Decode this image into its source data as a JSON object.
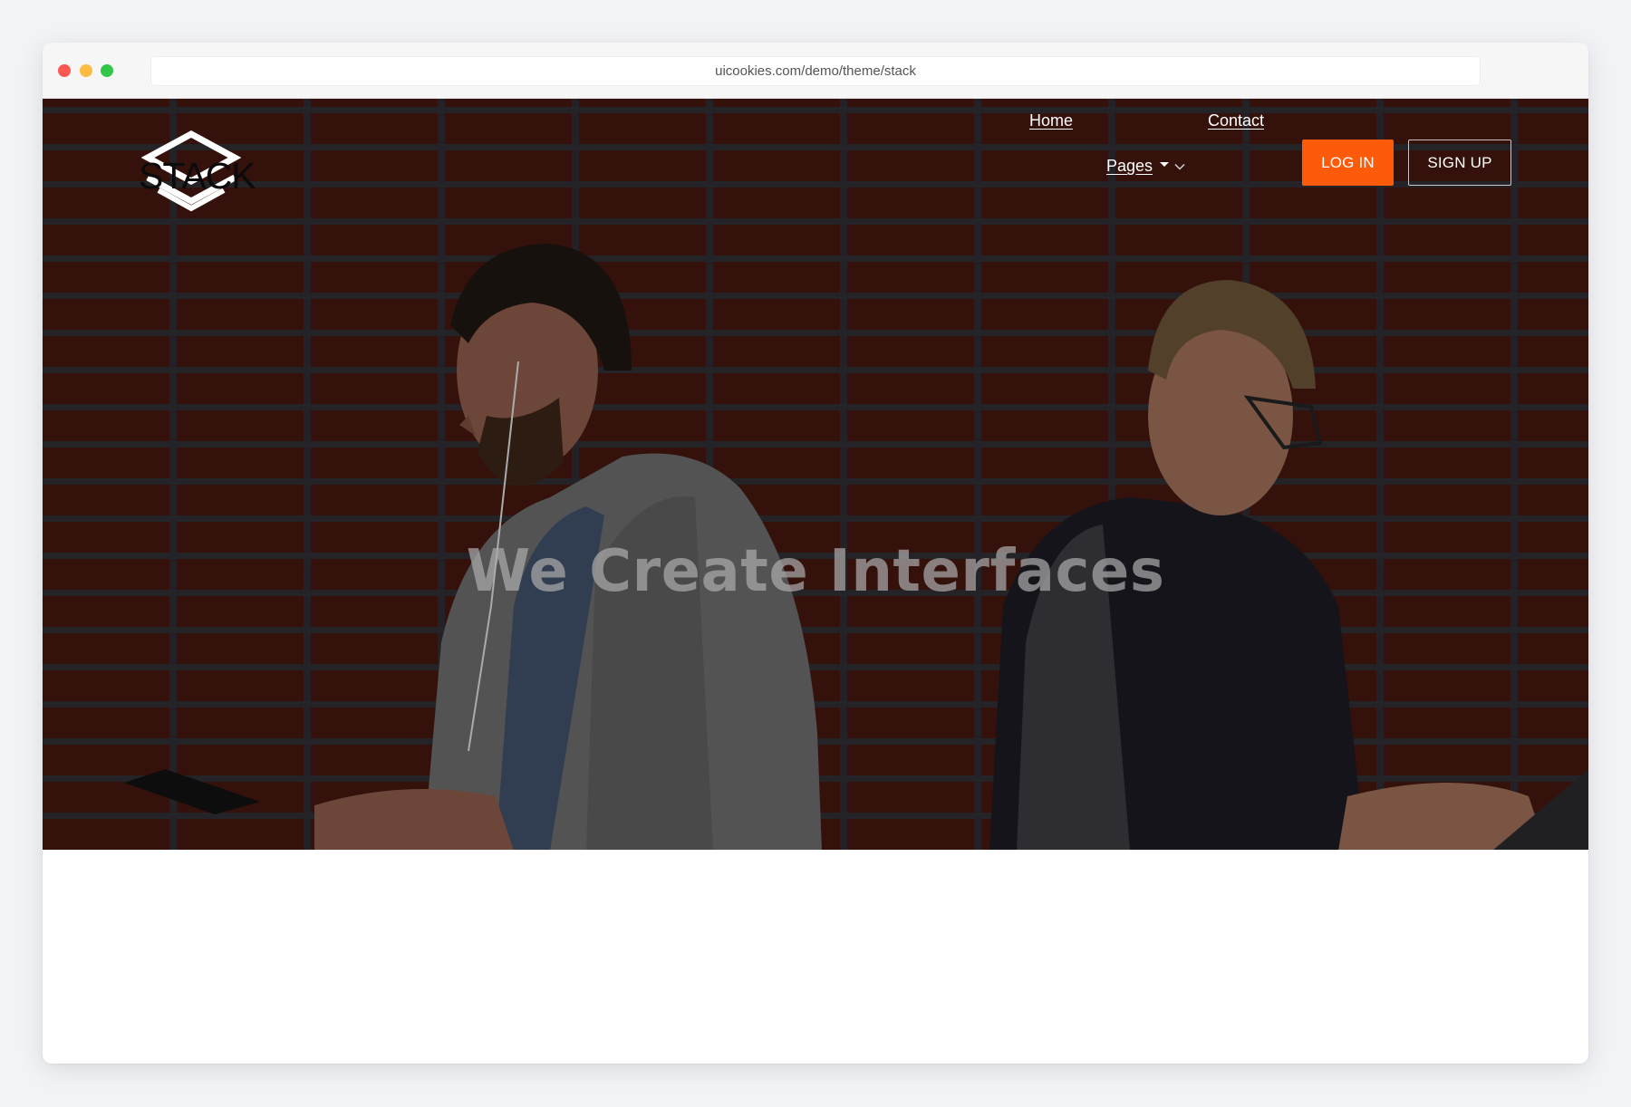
{
  "browser": {
    "url": "uicookies.com/demo/theme/stack",
    "traffic_lights": {
      "close": "#fc5753",
      "minimize": "#fdbc40",
      "zoom": "#33c748"
    }
  },
  "brand": {
    "logo_text": "STACK",
    "logo_color": "#ffffff"
  },
  "nav": {
    "home_label": "Home",
    "contact_label": "Contact",
    "pages_label": "Pages"
  },
  "actions": {
    "login_label": "LOG IN",
    "signup_label": "SIGN UP",
    "accent": "#fd5a0a"
  },
  "hero": {
    "headline": "We Create Interfaces",
    "background": "brick-wall-two-people-photo"
  }
}
